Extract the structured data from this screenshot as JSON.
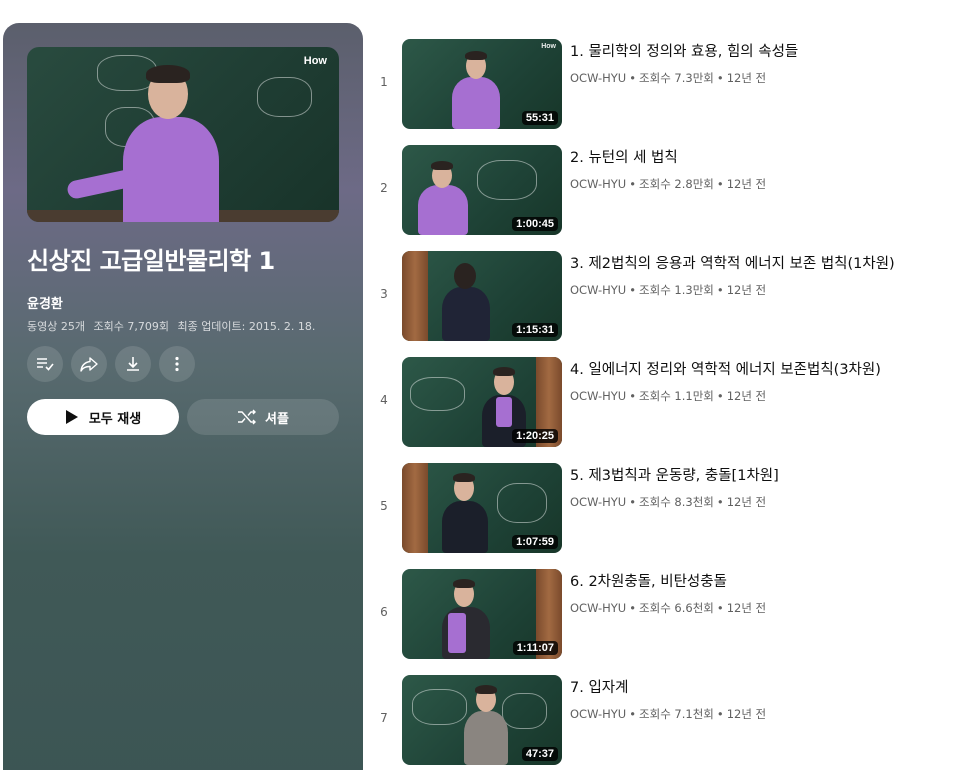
{
  "playlist": {
    "hero_logo": "How",
    "title": "신상진 고급일반물리학 1",
    "owner": "윤경환",
    "video_count": "동영상 25개",
    "views": "조회수 7,709회",
    "updated": "최종 업데이트: 2015. 2. 18.",
    "play_all_label": "모두 재생",
    "shuffle_label": "셔플",
    "icons": [
      "save-to-queue-icon",
      "share-icon",
      "download-icon",
      "more-icon"
    ]
  },
  "videos": [
    {
      "index": "1",
      "title": "1. 물리학의 정의와 효용, 힘의 속성들",
      "channel": "OCW-HYU",
      "views": "조회수 7.3만회",
      "age": "12년 전",
      "duration": "55:31"
    },
    {
      "index": "2",
      "title": "2. 뉴턴의 세 법칙",
      "channel": "OCW-HYU",
      "views": "조회수 2.8만회",
      "age": "12년 전",
      "duration": "1:00:45"
    },
    {
      "index": "3",
      "title": "3. 제2법칙의 응용과 역학적 에너지 보존 법칙(1차원)",
      "channel": "OCW-HYU",
      "views": "조회수 1.3만회",
      "age": "12년 전",
      "duration": "1:15:31"
    },
    {
      "index": "4",
      "title": "4. 일에너지 정리와 역학적 에너지 보존법칙(3차원)",
      "channel": "OCW-HYU",
      "views": "조회수 1.1만회",
      "age": "12년 전",
      "duration": "1:20:25"
    },
    {
      "index": "5",
      "title": "5. 제3법칙과 운동량, 충돌[1차원]",
      "channel": "OCW-HYU",
      "views": "조회수 8.3천회",
      "age": "12년 전",
      "duration": "1:07:59"
    },
    {
      "index": "6",
      "title": "6. 2차원충돌, 비탄성충돌",
      "channel": "OCW-HYU",
      "views": "조회수 6.6천회",
      "age": "12년 전",
      "duration": "1:11:07"
    },
    {
      "index": "7",
      "title": "7. 입자계",
      "channel": "OCW-HYU",
      "views": "조회수 7.1천회",
      "age": "12년 전",
      "duration": "47:37"
    }
  ],
  "colors": {
    "panel_top": "#6d6a86",
    "panel_bottom": "#3c5554",
    "chalkboard": "#1f4236",
    "sweater": "#a66fd1",
    "text_primary": "#0f0f0f",
    "text_secondary": "#606060"
  }
}
